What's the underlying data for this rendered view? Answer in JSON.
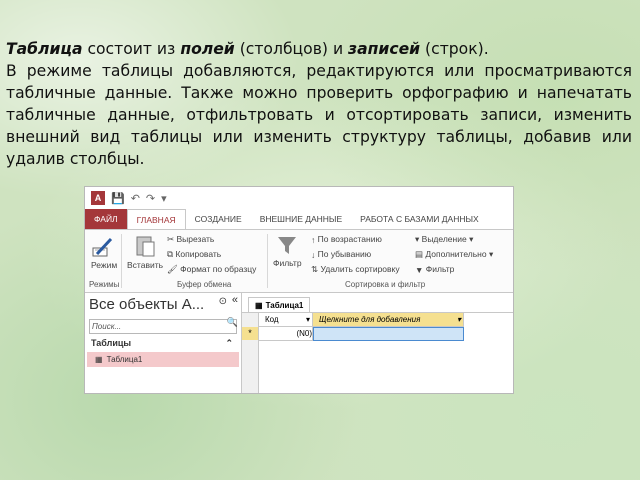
{
  "text": {
    "bold1": "Таблица",
    "part1": " состоит из ",
    "bold2": "полей",
    "part2": " (столбцов) и ",
    "bold3": "записей",
    "part3": " (строк).",
    "paragraph": "В режиме таблицы добавляются, редактируются или просматриваются табличные данные. Также можно проверить орфографию и напечатать табличные данные, отфильтровать и отсортировать записи, изменить внешний вид таблицы или изменить структуру таблицы, добавив или удалив столбцы."
  },
  "app": {
    "logo": "A",
    "tabs": [
      "ФАЙЛ",
      "ГЛАВНАЯ",
      "СОЗДАНИЕ",
      "ВНЕШНИЕ ДАННЫЕ",
      "РАБОТА С БАЗАМИ ДАННЫХ"
    ],
    "ribbon": {
      "mode_label": "Режим",
      "paste_label": "Вставить",
      "cut": "Вырезать",
      "copy": "Копировать",
      "format_painter": "Формат по образцу",
      "filter_label": "Фильтр",
      "sort_asc": "По возрастанию",
      "sort_desc": "По убыванию",
      "remove_sort": "Удалить сортировку",
      "selection": "Выделение",
      "advanced": "Дополнительно",
      "toggle_filter": "Фильтр",
      "groups": [
        "Режимы",
        "Буфер обмена",
        "Сортировка и фильтр"
      ]
    },
    "nav": {
      "title": "Все объекты А...",
      "search_placeholder": "Поиск...",
      "section": "Таблицы",
      "item": "Таблица1"
    },
    "doc": {
      "tab": "Таблица1",
      "col1": "Код",
      "col2": "Щелкните для добавления",
      "new_row_marker": "*",
      "new_row_value": "(N0)"
    }
  }
}
